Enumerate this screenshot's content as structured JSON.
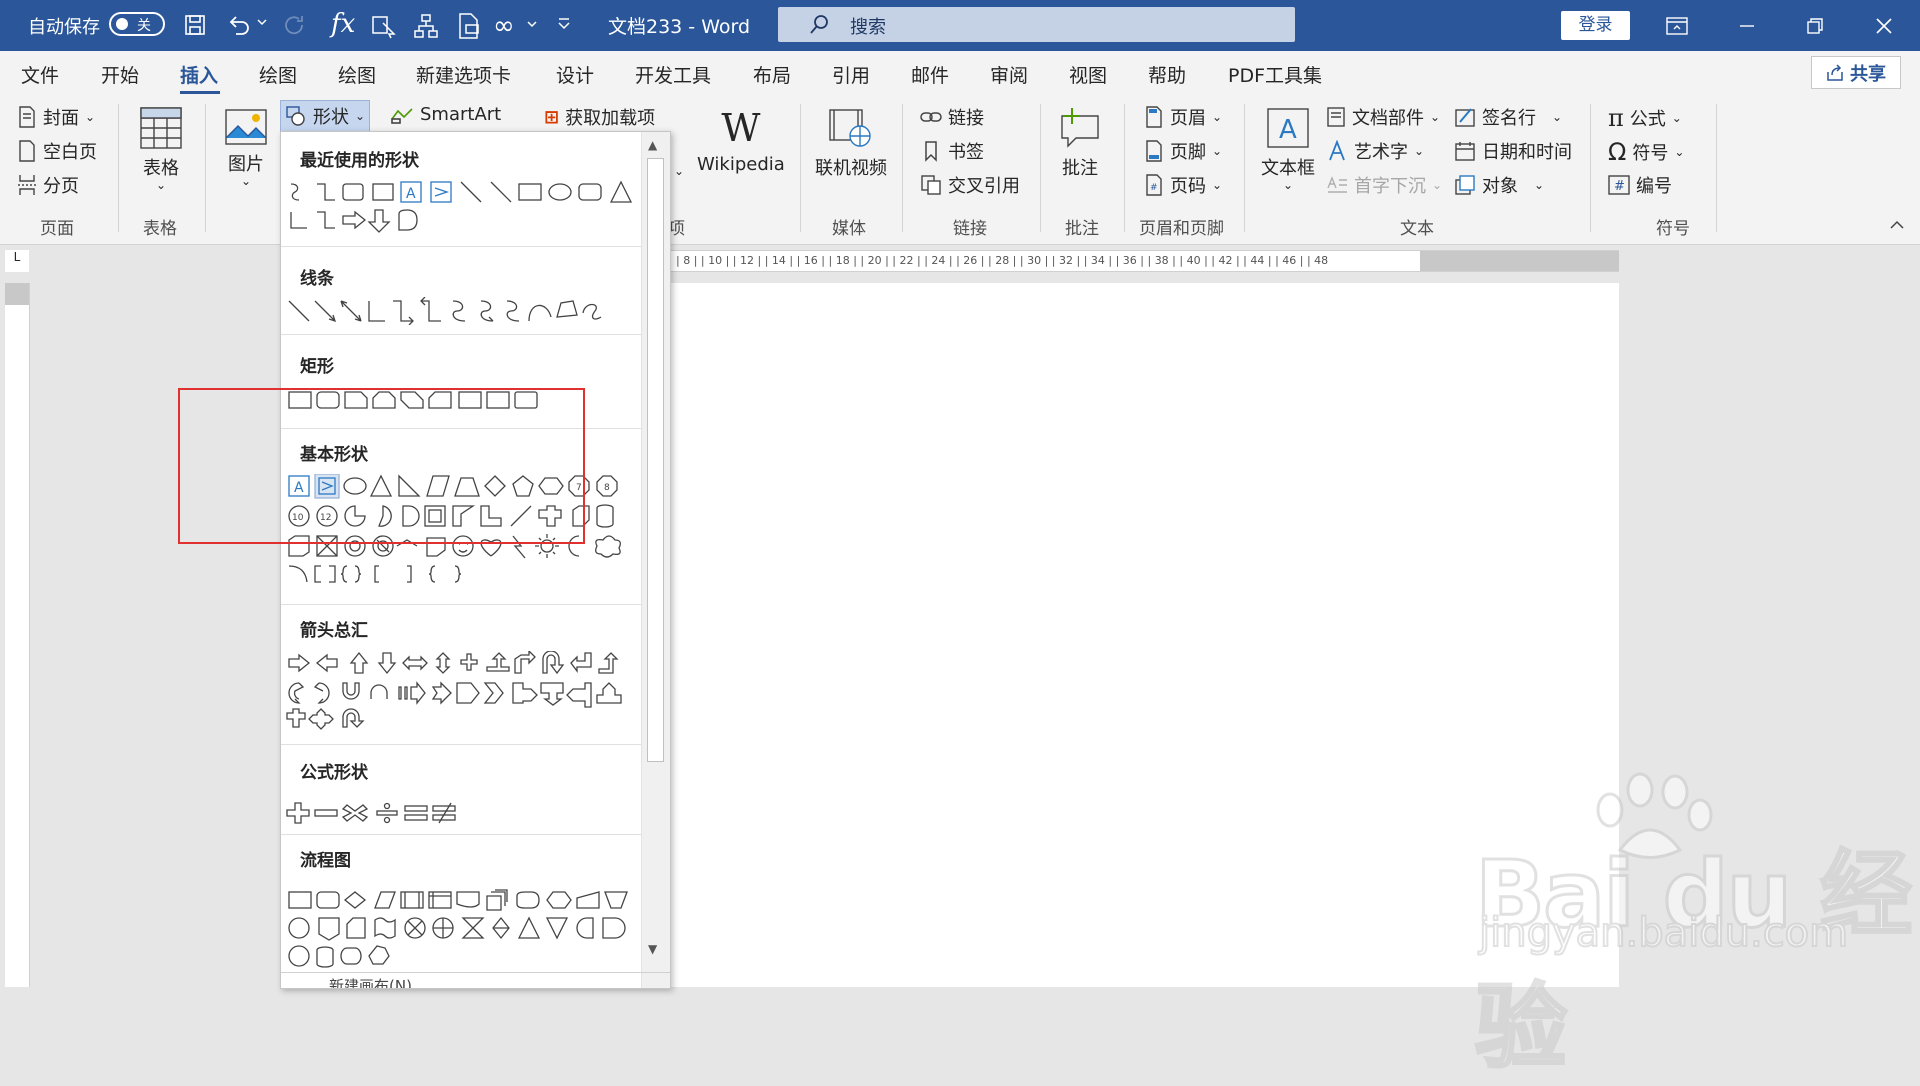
{
  "titlebar": {
    "autosave_label": "自动保存",
    "autosave_state": "关",
    "doc_title": "文档233  -  Word",
    "search_placeholder": "搜索",
    "login": "登录"
  },
  "tabs": [
    "文件",
    "开始",
    "插入",
    "绘图",
    "绘图",
    "新建选项卡",
    "设计",
    "开发工具",
    "布局",
    "引用",
    "邮件",
    "审阅",
    "视图",
    "帮助",
    "PDF工具集"
  ],
  "active_tab": "插入",
  "share": "共享",
  "ribbon": {
    "pages": {
      "cover": "封面",
      "blank": "空白页",
      "break": "分页",
      "group": "页面"
    },
    "table": {
      "label": "表格",
      "group": "表格"
    },
    "illus": {
      "picture": "图片",
      "shapes": "形状",
      "smartart": "SmartArt",
      "addins": "获取加载项",
      "addins_group": "项"
    },
    "wiki": "Wikipedia",
    "media": {
      "video": "联机视频",
      "group": "媒体"
    },
    "links": {
      "link": "链接",
      "bookmark": "书签",
      "crossref": "交叉引用",
      "group": "链接"
    },
    "comments": {
      "comment": "批注",
      "group": "批注"
    },
    "headerfooter": {
      "header": "页眉",
      "footer": "页脚",
      "pagenum": "页码",
      "group": "页眉和页脚"
    },
    "text": {
      "textbox": "文本框",
      "parts": "文档部件",
      "wordart": "艺术字",
      "dropcap": "首字下沉",
      "sigline": "签名行",
      "datetime": "日期和时间",
      "object": "对象",
      "group": "文本"
    },
    "symbols": {
      "equation": "公式",
      "symbol": "符号",
      "number": "编号",
      "group": "符号"
    }
  },
  "shapes_menu": {
    "sections": [
      "最近使用的形状",
      "线条",
      "矩形",
      "基本形状",
      "箭头总汇",
      "公式形状",
      "流程图"
    ],
    "footer": "新建画布(N)"
  },
  "ruler": {
    "h_ticks": "| 8 |   | 10 |   | 12 |   | 14 |   | 16 |   | 18 |   | 20 |   | 22 |   | 24 |   | 26 |   | 28 |   | 30 |   | 32 |   | 34 |   | 36 |   | 38 |   | 40 |   | 42 |   | 44 |   | 46 |   | 48"
  },
  "watermark": {
    "brand": "Bai du 经验",
    "url": "jingyan.baidu.com"
  }
}
